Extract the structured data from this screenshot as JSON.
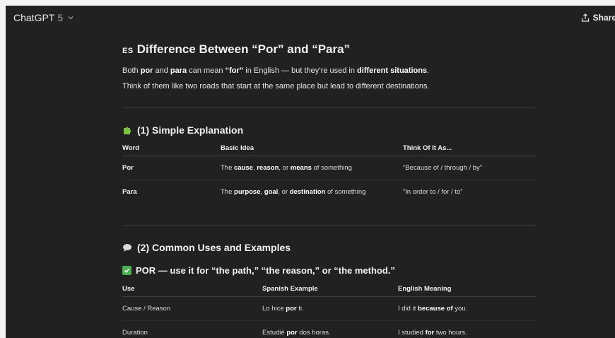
{
  "header": {
    "model_name": "ChatGPT",
    "model_version": "5",
    "share_label": "Share"
  },
  "intro": {
    "flag": "ES",
    "title": "Difference Between “Por” and “Para”",
    "line1": [
      {
        "t": "Both ",
        "b": false
      },
      {
        "t": "por",
        "b": true
      },
      {
        "t": " and ",
        "b": false
      },
      {
        "t": "para",
        "b": true
      },
      {
        "t": " can mean ",
        "b": false
      },
      {
        "t": "“for”",
        "b": true
      },
      {
        "t": " in English — but they’re used in ",
        "b": false
      },
      {
        "t": "different situations",
        "b": true
      },
      {
        "t": ".",
        "b": false
      }
    ],
    "line2": "Think of them like two roads that start at the same place but lead to different destinations."
  },
  "section1": {
    "icon": "puzzle-icon",
    "title": "(1) Simple Explanation",
    "columns": [
      "Word",
      "Basic Idea",
      "Think Of It As..."
    ],
    "rows": [
      {
        "word": "Por",
        "idea": [
          {
            "t": "The ",
            "b": false
          },
          {
            "t": "cause",
            "b": true
          },
          {
            "t": ", ",
            "b": false
          },
          {
            "t": "reason",
            "b": true
          },
          {
            "t": ", or ",
            "b": false
          },
          {
            "t": "means",
            "b": true
          },
          {
            "t": " of something",
            "b": false
          }
        ],
        "think": "“Because of / through / by”"
      },
      {
        "word": "Para",
        "idea": [
          {
            "t": "The ",
            "b": false
          },
          {
            "t": "purpose",
            "b": true
          },
          {
            "t": ", ",
            "b": false
          },
          {
            "t": "goal",
            "b": true
          },
          {
            "t": ", or ",
            "b": false
          },
          {
            "t": "destination",
            "b": true
          },
          {
            "t": " of something",
            "b": false
          }
        ],
        "think": "“In order to / for / to”"
      }
    ]
  },
  "section2": {
    "icon": "speech-bubble-icon",
    "title": "(2) Common Uses and Examples",
    "sub_icon": "check-box-icon",
    "subtitle": "POR — use it for “the path,” “the reason,” or “the method.”",
    "columns": [
      "Use",
      "Spanish Example",
      "English Meaning"
    ],
    "rows": [
      {
        "use": "Cause / Reason",
        "spanish": [
          {
            "t": "Lo hice ",
            "b": false
          },
          {
            "t": "por",
            "b": true
          },
          {
            "t": " ti.",
            "b": false
          }
        ],
        "english": [
          {
            "t": "I did it ",
            "b": false
          },
          {
            "t": "because of",
            "b": true
          },
          {
            "t": " you.",
            "b": false
          }
        ]
      },
      {
        "use": "Duration",
        "spanish": [
          {
            "t": "Estudié ",
            "b": false
          },
          {
            "t": "por",
            "b": true
          },
          {
            "t": " dos horas.",
            "b": false
          }
        ],
        "english": [
          {
            "t": "I studied ",
            "b": false
          },
          {
            "t": "for",
            "b": true
          },
          {
            "t": " two hours.",
            "b": false
          }
        ]
      }
    ]
  },
  "colors": {
    "background": "#212121",
    "check_green": "#4caf50"
  }
}
